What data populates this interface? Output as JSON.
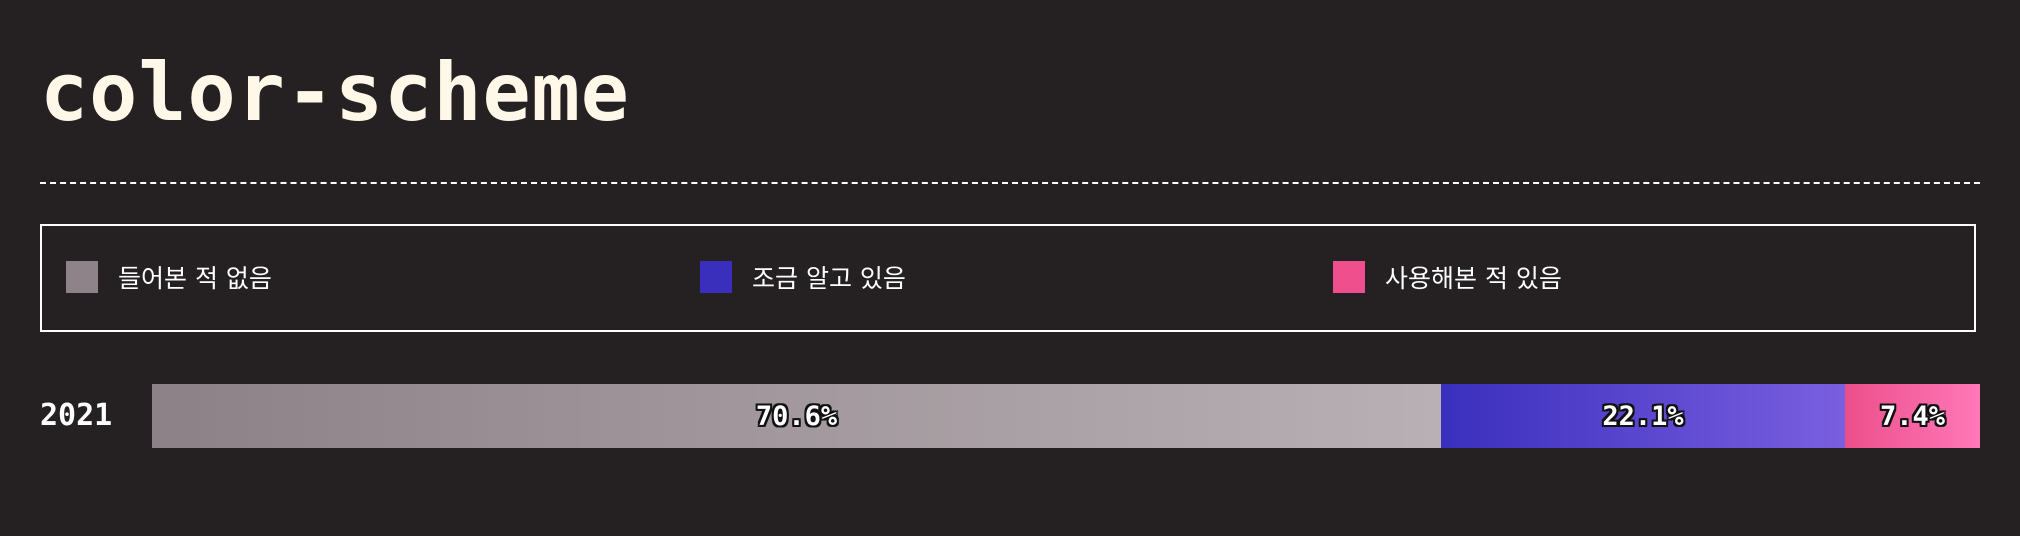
{
  "title": "color-scheme",
  "legend": [
    {
      "label": "들어본 적 없음",
      "color": "#8d8389"
    },
    {
      "label": "조금 알고 있음",
      "color": "#3a2fbd"
    },
    {
      "label": "사용해본 적 있음",
      "color": "#ef4f8c"
    }
  ],
  "chart_data": {
    "type": "bar",
    "orientation": "horizontal-stacked",
    "title": "color-scheme",
    "categories": [
      "2021"
    ],
    "series": [
      {
        "name": "들어본 적 없음",
        "values": [
          70.6
        ],
        "label": "70.6%",
        "color_start": "#8c8187",
        "color_end": "#b8b0b4"
      },
      {
        "name": "조금 알고 있음",
        "values": [
          22.1
        ],
        "label": "22.1%",
        "color_start": "#3a2fbd",
        "color_end": "#7a5fe0"
      },
      {
        "name": "사용해본 적 있음",
        "values": [
          7.4
        ],
        "label": "7.4%",
        "color_start": "#ec4f8a",
        "color_end": "#ff78b8"
      }
    ],
    "legend_position": "top",
    "grid": false
  }
}
